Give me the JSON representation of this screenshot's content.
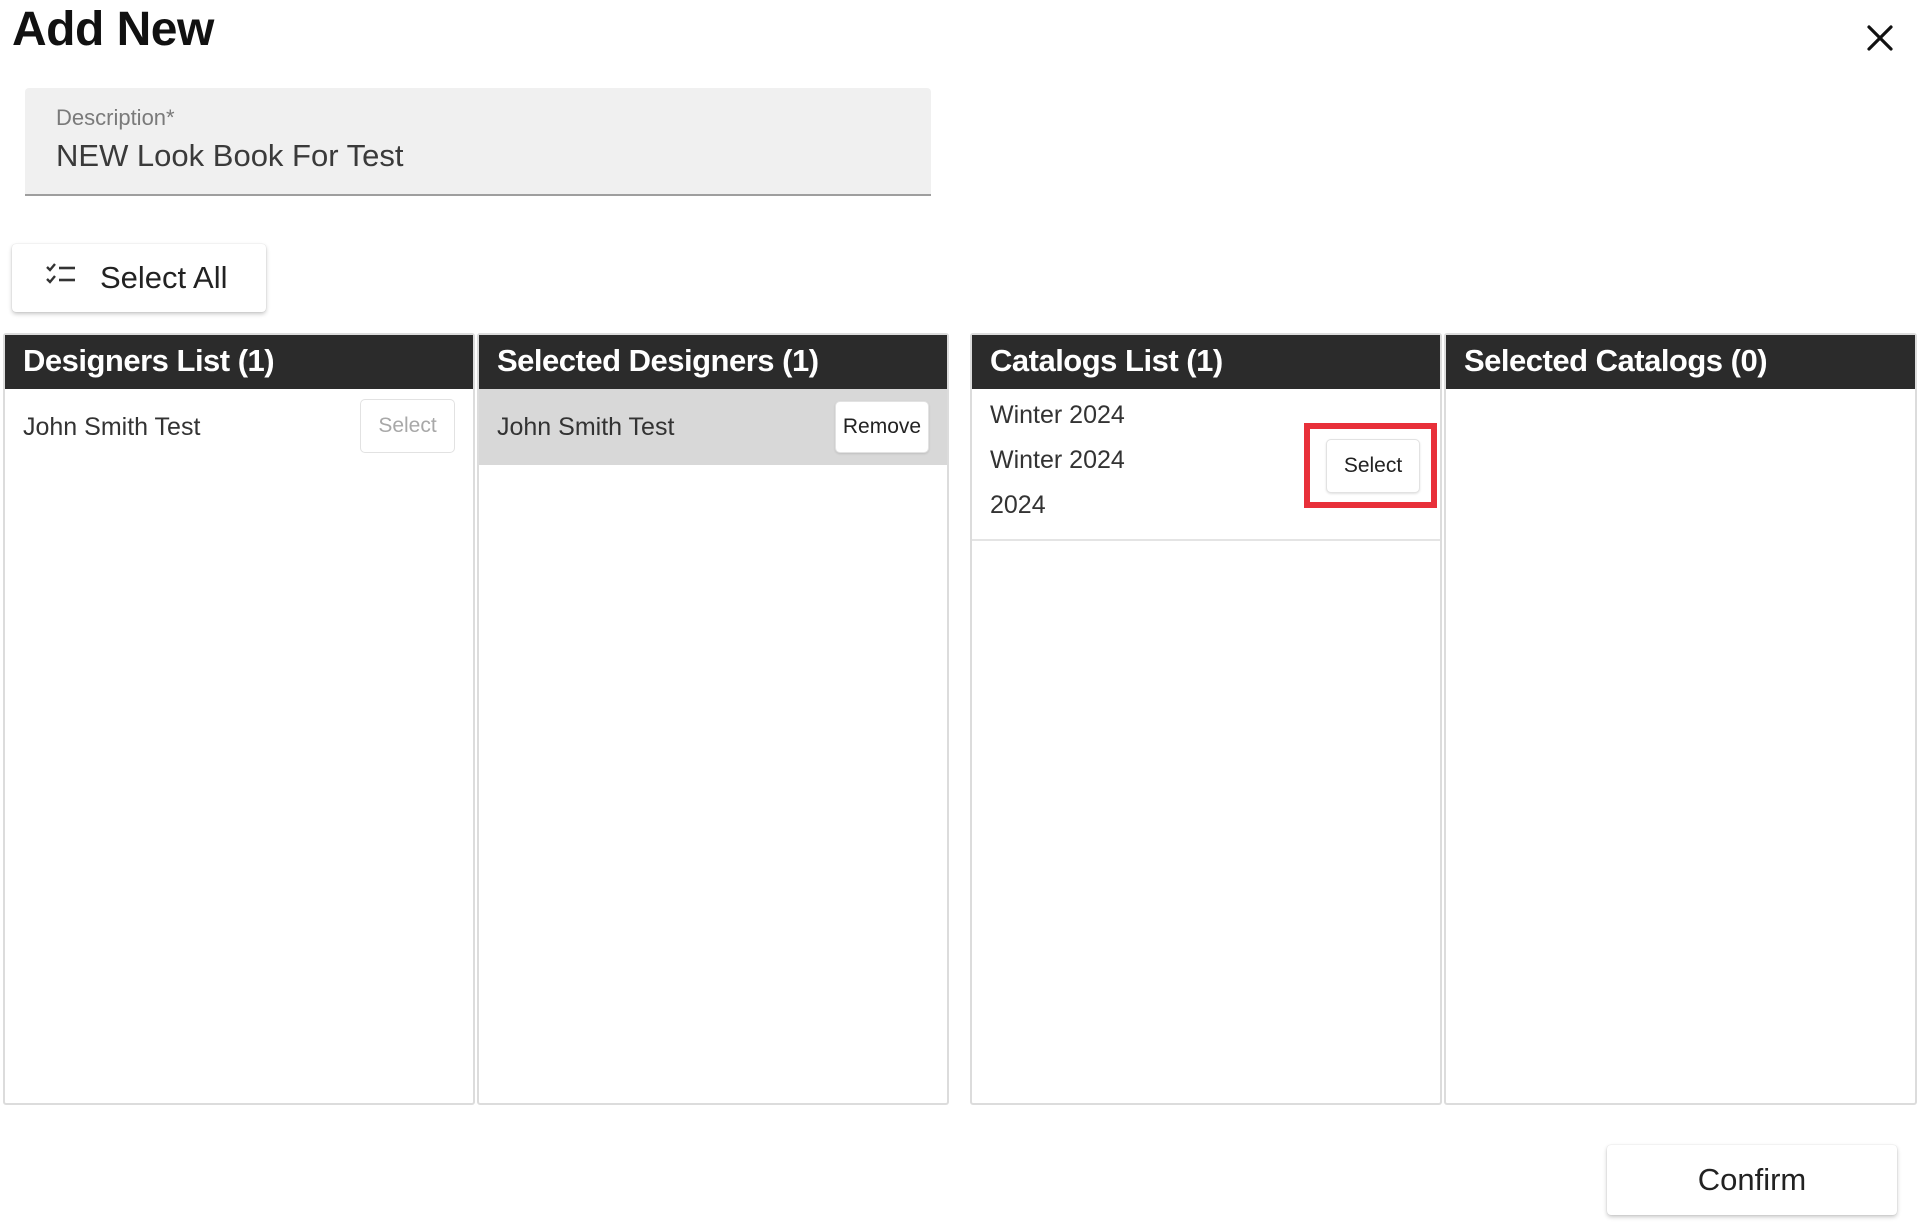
{
  "dialog": {
    "title": "Add New",
    "close_icon": "close-icon"
  },
  "description": {
    "label": "Description*",
    "value": "NEW Look Book For Test"
  },
  "toolbar": {
    "select_all_label": "Select All",
    "select_all_icon": "checklist-icon"
  },
  "panels": {
    "designers_list": {
      "header": "Designers List (1)",
      "items": [
        {
          "name": "John Smith Test",
          "action": "Select",
          "action_disabled": true
        }
      ]
    },
    "selected_designers": {
      "header": "Selected Designers (1)",
      "items": [
        {
          "name": "John Smith Test",
          "action": "Remove"
        }
      ]
    },
    "catalogs_list": {
      "header": "Catalogs List (1)",
      "items": [
        {
          "line1": "Winter 2024",
          "line2": "Winter 2024",
          "line3": "2024",
          "action": "Select"
        }
      ]
    },
    "selected_catalogs": {
      "header": "Selected Catalogs (0)",
      "items": []
    }
  },
  "footer": {
    "confirm_label": "Confirm"
  },
  "colors": {
    "header_bg": "#2b2b2b",
    "highlight_row": "#d8d8d8",
    "annotation_box": "#e8303a"
  }
}
